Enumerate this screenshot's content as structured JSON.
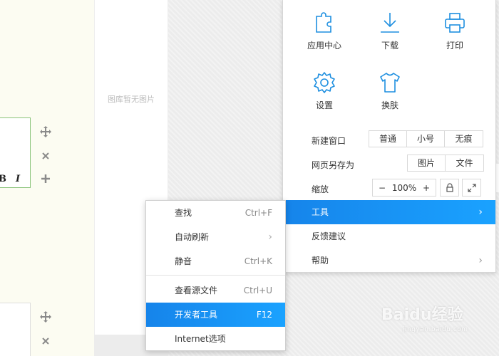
{
  "background": {
    "gallery_empty_text": "图库暂无图片",
    "editor_bold": "B",
    "editor_italic": "I",
    "tools": [
      "move-icon",
      "close-icon",
      "plus-icon"
    ]
  },
  "menu": {
    "grid": [
      {
        "label": "应用中心",
        "icon": "puzzle-icon"
      },
      {
        "label": "下载",
        "icon": "download-icon"
      },
      {
        "label": "打印",
        "icon": "printer-icon"
      },
      {
        "label": "设置",
        "icon": "gear-icon"
      },
      {
        "label": "换肤",
        "icon": "tshirt-icon"
      }
    ],
    "new_window": {
      "label": "新建窗口",
      "options": [
        "普通",
        "小号",
        "无痕"
      ]
    },
    "save_as": {
      "label": "网页另存为",
      "options": [
        "图片",
        "文件"
      ]
    },
    "zoom": {
      "label": "缩放",
      "minus": "−",
      "value": "100%",
      "plus": "+"
    },
    "rows": [
      {
        "label": "工具",
        "highlighted": true
      },
      {
        "label": "反馈建议"
      },
      {
        "label": "帮助"
      }
    ]
  },
  "submenu": {
    "items": [
      {
        "label": "查找",
        "shortcut": "Ctrl+F"
      },
      {
        "label": "自动刷新",
        "shortcut": "›"
      },
      {
        "label": "静音",
        "shortcut": "Ctrl+K"
      },
      {
        "label": "查看源文件",
        "shortcut": "Ctrl+U"
      },
      {
        "label": "开发者工具",
        "shortcut": "F12",
        "highlighted": true
      },
      {
        "label": "Internet选项",
        "shortcut": ""
      }
    ]
  },
  "watermark": {
    "text": "Baidu经验",
    "sub": "jingyan.baidu.com"
  },
  "colors": {
    "accent": "#1795f5",
    "icon": "#1e8fe0"
  }
}
